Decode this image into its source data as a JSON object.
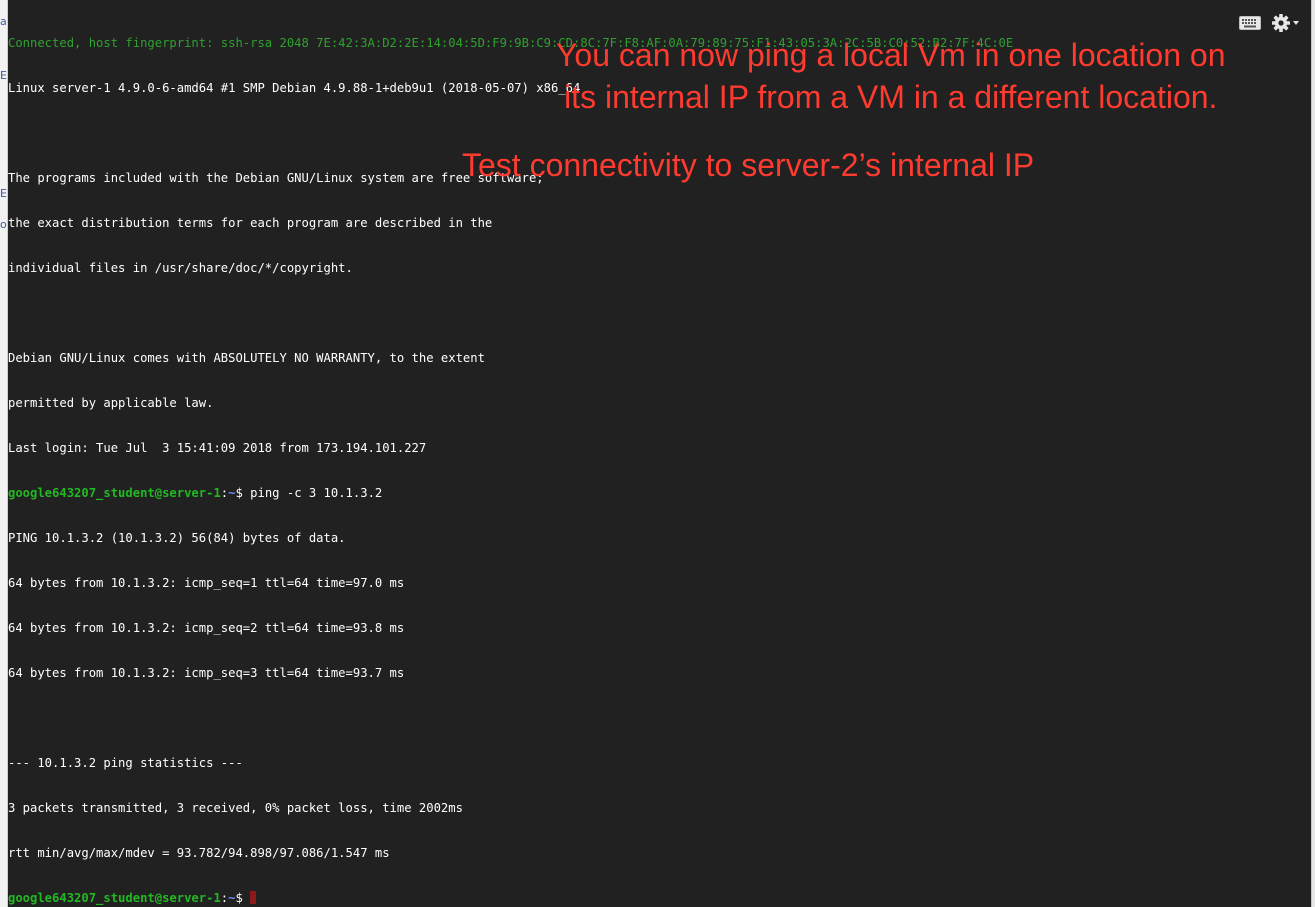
{
  "left_edge": {
    "letters": [
      "a",
      "E",
      "E",
      "o"
    ]
  },
  "terminal": {
    "fingerprint_line": "Connected, host fingerprint: ssh-rsa 2048 7E:42:3A:D2:2E:14:04:5D:F9:9B:C9:CD:8C:7F:F8:AF:0A:79:89:75:F1:43:05:3A:2C:5B:C0:52:B2:7F:4C:0E",
    "lines": [
      "Linux server-1 4.9.0-6-amd64 #1 SMP Debian 4.9.88-1+deb9u1 (2018-05-07) x86_64",
      "",
      "The programs included with the Debian GNU/Linux system are free software;",
      "the exact distribution terms for each program are described in the",
      "individual files in /usr/share/doc/*/copyright.",
      "",
      "Debian GNU/Linux comes with ABSOLUTELY NO WARRANTY, to the extent",
      "permitted by applicable law.",
      "Last login: Tue Jul  3 15:41:09 2018 from 173.194.101.227"
    ],
    "prompt": {
      "user": "google643207_student@server-1",
      "sep": ":",
      "path": "~",
      "symbol": "$ "
    },
    "command": "ping -c 3 10.1.3.2",
    "output": [
      "PING 10.1.3.2 (10.1.3.2) 56(84) bytes of data.",
      "64 bytes from 10.1.3.2: icmp_seq=1 ttl=64 time=97.0 ms",
      "64 bytes from 10.1.3.2: icmp_seq=2 ttl=64 time=93.8 ms",
      "64 bytes from 10.1.3.2: icmp_seq=3 ttl=64 time=93.7 ms",
      "",
      "--- 10.1.3.2 ping statistics ---",
      "3 packets transmitted, 3 received, 0% packet loss, time 2002ms",
      "rtt min/avg/max/mdev = 93.782/94.898/97.086/1.547 ms"
    ]
  },
  "toolbar": {
    "keyboard_icon": "keyboard-icon",
    "settings_icon": "gear-icon"
  },
  "annotations": {
    "note_line1": "You can now ping a local Vm in one location on",
    "note_line2": "its internal IP from a VM in a different location.",
    "test_note": "Test connectivity to server-2’s internal IP"
  },
  "colors": {
    "terminal_bg": "#212121",
    "prompt_user": "#22b822",
    "prompt_path": "#6b8cff",
    "fingerprint": "#2fa12f",
    "annotation": "#ff3b30",
    "cursor": "#8b1a1a"
  }
}
